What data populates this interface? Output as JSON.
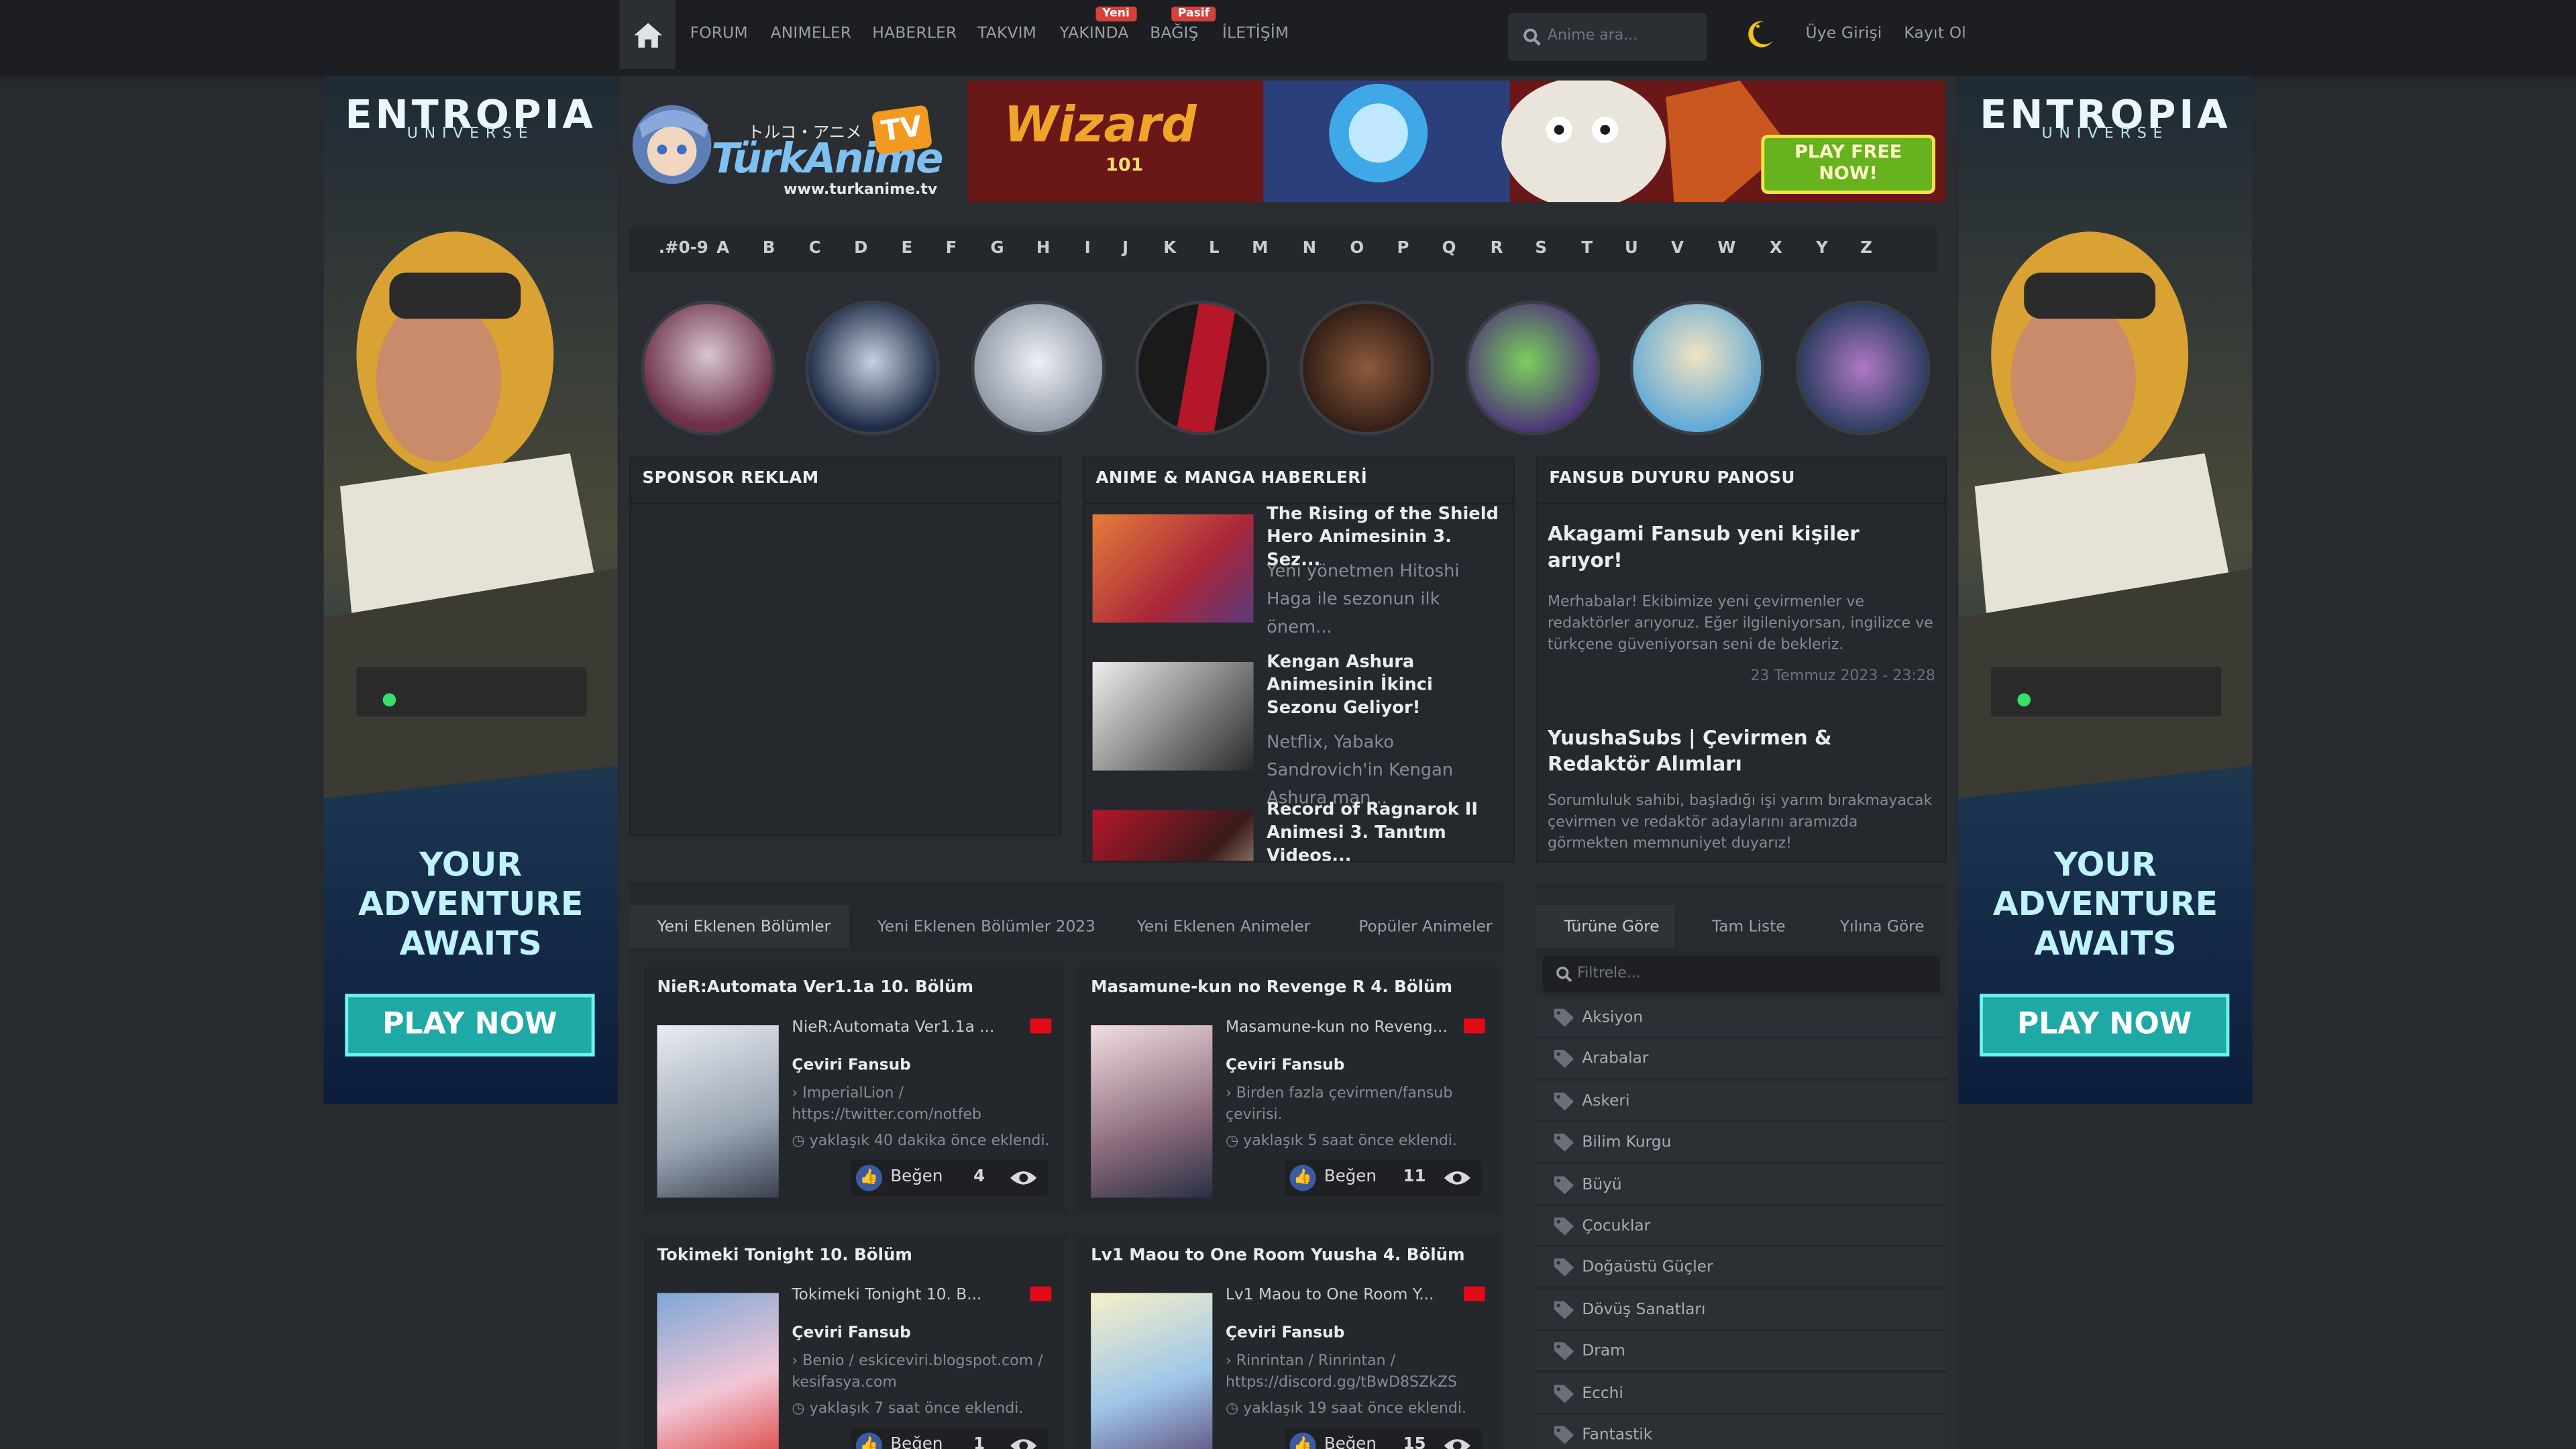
{
  "nav": {
    "links": [
      "FORUM",
      "ANIMELER",
      "HABERLER",
      "TAKVIM",
      "YAKINDA",
      "BAĞIŞ",
      "İLETİŞİM"
    ],
    "badges": {
      "yakinda": "Yeni",
      "bagis": "Pasif"
    },
    "search_placeholder": "Anime ara...",
    "login": "Üye Girişi",
    "register": "Kayıt Ol"
  },
  "ads": {
    "side_brand": "ENTROPIA",
    "side_sub": "UNIVERSE",
    "side_slogan_1": "YOUR",
    "side_slogan_2": "ADVENTURE",
    "side_slogan_3": "AWAITS",
    "side_cta": "PLAY NOW",
    "banner_brand": "Wizard",
    "banner_num": "101",
    "banner_cta_1": "PLAY FREE",
    "banner_cta_2": "NOW!"
  },
  "logo": {
    "jp": "トルコ・アニメ",
    "name": "TürkAnime",
    "tv": "TV",
    "url": "www.turkanime.tv"
  },
  "alphabet": [
    ".#0-9",
    "A",
    "B",
    "C",
    "D",
    "E",
    "F",
    "G",
    "H",
    "I",
    "J",
    "K",
    "L",
    "M",
    "N",
    "O",
    "P",
    "Q",
    "R",
    "S",
    "T",
    "U",
    "V",
    "W",
    "X",
    "Y",
    "Z"
  ],
  "sponsor": {
    "title": "SPONSOR REKLAM"
  },
  "news": {
    "title": "ANIME & MANGA HABERLERİ",
    "items": [
      {
        "title": "The Rising of the Shield Hero Animesinin 3. Sez...",
        "desc": "Yeni yönetmen Hitoshi Haga ile sezonun ilk önem..."
      },
      {
        "title": "Kengan Ashura Animesinin İkinci Sezonu Geliyor!",
        "desc": "Netflix, Yabako Sandrovich'in Kengan Ashura man..."
      },
      {
        "title": "Record of Ragnarok II Animesi 3. Tanıtım Videos...",
        "desc": ""
      }
    ]
  },
  "fansub": {
    "title": "FANSUB DUYURU PANOSU",
    "items": [
      {
        "title": "Akagami Fansub yeni kişiler arıyor!",
        "desc": "Merhabalar! Ekibimize yeni çevirmenler ve redaktörler arıyoruz. Eğer ilgileniyorsan, ingilizce ve türkçene güveniyorsan seni de bekleriz.",
        "date": "23 Temmuz 2023 - 23:28"
      },
      {
        "title": "YuushaSubs | Çevirmen & Redaktör Alımları",
        "desc": "Sorumluluk sahibi, başladığı işi yarım bırakmayacak çevirmen ve redaktör adaylarını aramızda görmekten memnuniyet duyarız!",
        "date": ""
      }
    ]
  },
  "episodes": {
    "tabs": [
      "Yeni Eklenen Bölümler",
      "Yeni Eklenen Bölümler 2023",
      "Yeni Eklenen Animeler",
      "Popüler Animeler"
    ],
    "like_label": "Beğen",
    "fansub_label": "Çeviri Fansub",
    "cards": [
      {
        "title": "NieR:Automata Ver1.1a 10. Bölüm",
        "info": "NieR:Automata Ver1.1a ...",
        "source": "ImperialLion / https://twitter.com/notfeb",
        "time": "yaklaşık 40 dakika önce eklendi.",
        "likes": "4"
      },
      {
        "title": "Masamune-kun no Revenge R 4. Bölüm",
        "info": "Masamune-kun no Reveng...",
        "source": "Birden fazla çevirmen/fansub çevirisi.",
        "time": "yaklaşık 5 saat önce eklendi.",
        "likes": "11"
      },
      {
        "title": "Tokimeki Tonight 10. Bölüm",
        "info": "Tokimeki Tonight 10. B...",
        "source": "Benio / eskiceviri.blogspot.com / kesifasya.com",
        "time": "yaklaşık 7 saat önce eklendi.",
        "likes": "1"
      },
      {
        "title": "Lv1 Maou to One Room Yuusha 4. Bölüm",
        "info": "Lv1 Maou to One Room Y...",
        "source": "Rinrintan / Rinrintan / https://discord.gg/tBwD8SZkZS",
        "time": "yaklaşık 19 saat önce eklendi.",
        "likes": "15"
      }
    ]
  },
  "genres": {
    "tabs": [
      "Türüne Göre",
      "Tam Liste",
      "Yılına Göre"
    ],
    "filter_placeholder": "Filtrele...",
    "items": [
      "Aksiyon",
      "Arabalar",
      "Askeri",
      "Bilim Kurgu",
      "Büyü",
      "Çocuklar",
      "Doğaüstü Güçler",
      "Dövüş Sanatları",
      "Dram",
      "Ecchi",
      "Fantastik"
    ]
  },
  "colors": {
    "accent": "#d4413a",
    "bg": "#272a2f",
    "nav": "#1c1e22",
    "flag": "#e30a17"
  }
}
